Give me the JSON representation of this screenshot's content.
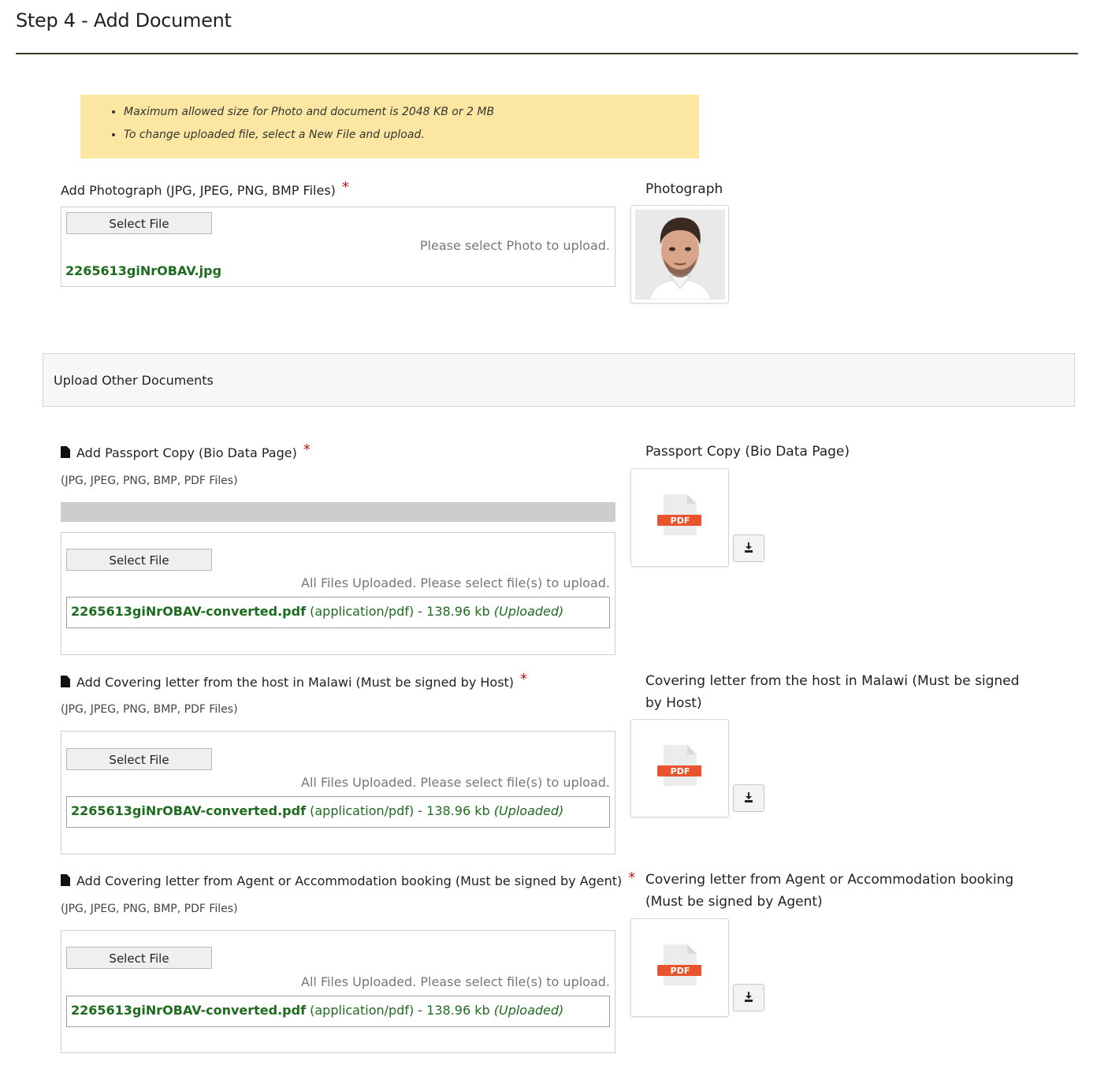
{
  "header": {
    "title": "Step 4 - Add Document"
  },
  "notice": {
    "items": [
      "Maximum allowed size for Photo and document is 2048 KB or 2 MB",
      "To change uploaded file, select a New File and upload."
    ]
  },
  "photo": {
    "label": "Add Photograph (JPG, JPEG, PNG, BMP Files)",
    "required_mark": "*",
    "select_button": "Select File",
    "hint": "Please select Photo to upload.",
    "filename": "2265613giNrOBAV.jpg",
    "preview_title": "Photograph"
  },
  "other_docs": {
    "title": "Upload Other Documents"
  },
  "documents": [
    {
      "label": "Add Passport Copy (Bio Data Page)",
      "required_mark": "*",
      "formats": "(JPG, JPEG, PNG, BMP, PDF Files)",
      "select_button": "Select File",
      "hint": "All Files Uploaded. Please select file(s) to upload.",
      "file_name": "2265613giNrOBAV-converted.pdf",
      "file_meta": " (application/pdf) - 138.96 kb ",
      "file_status": "(Uploaded)",
      "preview_title": "Passport Copy (Bio Data Page)",
      "preview_badge": "PDF"
    },
    {
      "label": "Add Covering letter from the host in Malawi (Must be signed by Host)",
      "required_mark": "*",
      "formats": "(JPG, JPEG, PNG, BMP, PDF Files)",
      "select_button": "Select File",
      "hint": "All Files Uploaded. Please select file(s) to upload.",
      "file_name": "2265613giNrOBAV-converted.pdf",
      "file_meta": " (application/pdf) - 138.96 kb ",
      "file_status": "(Uploaded)",
      "preview_title": "Covering letter from the host in Malawi (Must be signed by Host)",
      "preview_badge": "PDF"
    },
    {
      "label": "Add Covering letter from Agent or Accommodation booking (Must be signed by Agent)",
      "required_mark": "*",
      "formats": "(JPG, JPEG, PNG, BMP, PDF Files)",
      "select_button": "Select File",
      "hint": "All Files Uploaded. Please select file(s) to upload.",
      "file_name": "2265613giNrOBAV-converted.pdf",
      "file_meta": " (application/pdf) - 138.96 kb ",
      "file_status": "(Uploaded)",
      "preview_title": "Covering letter from Agent or Accommodation booking (Must be signed by Agent)",
      "preview_badge": "PDF"
    }
  ],
  "colors": {
    "notice_bg": "#fbe7a1",
    "filename_green": "#1d6b1d",
    "required_red": "#c0141a",
    "pdf_badge": "#e8542d"
  },
  "icons": [
    "file-icon",
    "download-icon",
    "pdf-file-icon"
  ]
}
